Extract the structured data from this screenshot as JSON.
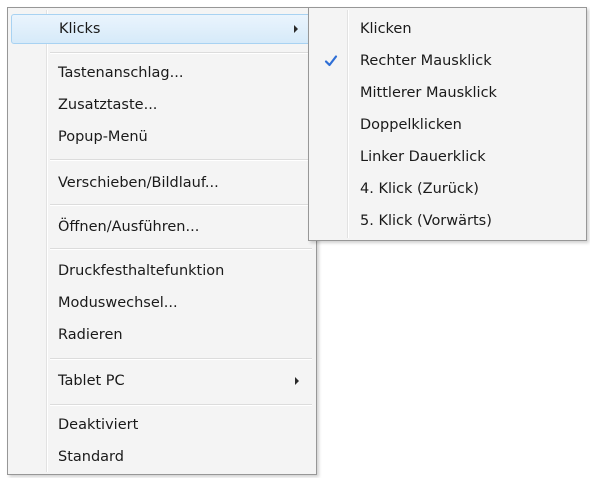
{
  "main_menu": {
    "items": [
      {
        "label": "Klicks",
        "has_submenu": true,
        "highlighted": true
      },
      {
        "label": "Tastenanschlag..."
      },
      {
        "label": "Zusatztaste..."
      },
      {
        "label": "Popup-Menü"
      },
      {
        "label": "Verschieben/Bildlauf..."
      },
      {
        "label": "Öffnen/Ausführen..."
      },
      {
        "label": "Druckfesthaltefunktion"
      },
      {
        "label": "Moduswechsel..."
      },
      {
        "label": "Radieren"
      },
      {
        "label": "Tablet PC",
        "has_submenu": true
      },
      {
        "label": "Deaktiviert"
      },
      {
        "label": "Standard"
      }
    ]
  },
  "sub_menu": {
    "items": [
      {
        "label": "Klicken"
      },
      {
        "label": "Rechter Mausklick",
        "checked": true
      },
      {
        "label": "Mittlerer Mausklick"
      },
      {
        "label": "Doppelklicken"
      },
      {
        "label": "Linker Dauerklick"
      },
      {
        "label": "4. Klick (Zurück)"
      },
      {
        "label": "5. Klick (Vorwärts)"
      }
    ]
  },
  "icons": {
    "submenu_arrow": "chevron-right-icon",
    "checkmark": "checkmark-icon"
  },
  "colors": {
    "highlight_border": "#a8d2f2",
    "highlight_fill": "#d6eaf9",
    "checkmark": "#2f6fd6",
    "menu_background": "#f4f4f4"
  }
}
